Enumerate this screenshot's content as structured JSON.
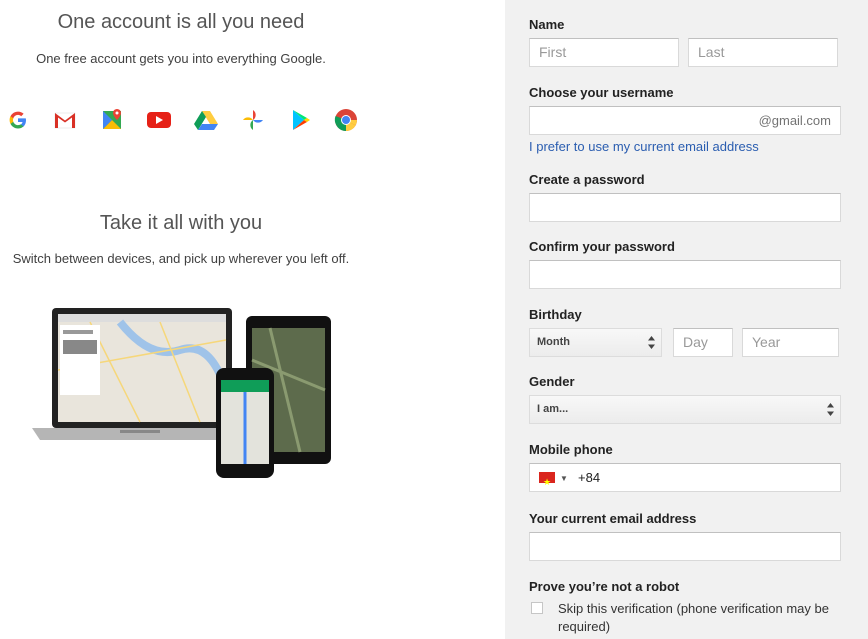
{
  "left": {
    "heading1": "One account is all you need",
    "sub1": "One free account gets you into everything Google.",
    "heading2": "Take it all with you",
    "sub2": "Switch between devices, and pick up wherever you left off.",
    "icons": [
      "google-g-icon",
      "gmail-icon",
      "maps-icon",
      "youtube-icon",
      "drive-icon",
      "photos-icon",
      "play-store-icon",
      "chrome-icon"
    ]
  },
  "form": {
    "name_label": "Name",
    "first_placeholder": "First",
    "last_placeholder": "Last",
    "username_label": "Choose your username",
    "username_suffix": "@gmail.com",
    "current_email_link": "I prefer to use my current email address",
    "password_label": "Create a password",
    "confirm_label": "Confirm your password",
    "birthday_label": "Birthday",
    "month_value": "Month",
    "day_placeholder": "Day",
    "year_placeholder": "Year",
    "gender_label": "Gender",
    "gender_value": "I am...",
    "phone_label": "Mobile phone",
    "phone_code": "+84",
    "current_email_label": "Your current email address",
    "robot_label": "Prove you’re not a robot",
    "skip_text": "Skip this verification (phone verification may be required)"
  },
  "colors": {
    "panel_bg": "#f1f1f1",
    "link": "#2a5db0",
    "label": "#222222"
  }
}
